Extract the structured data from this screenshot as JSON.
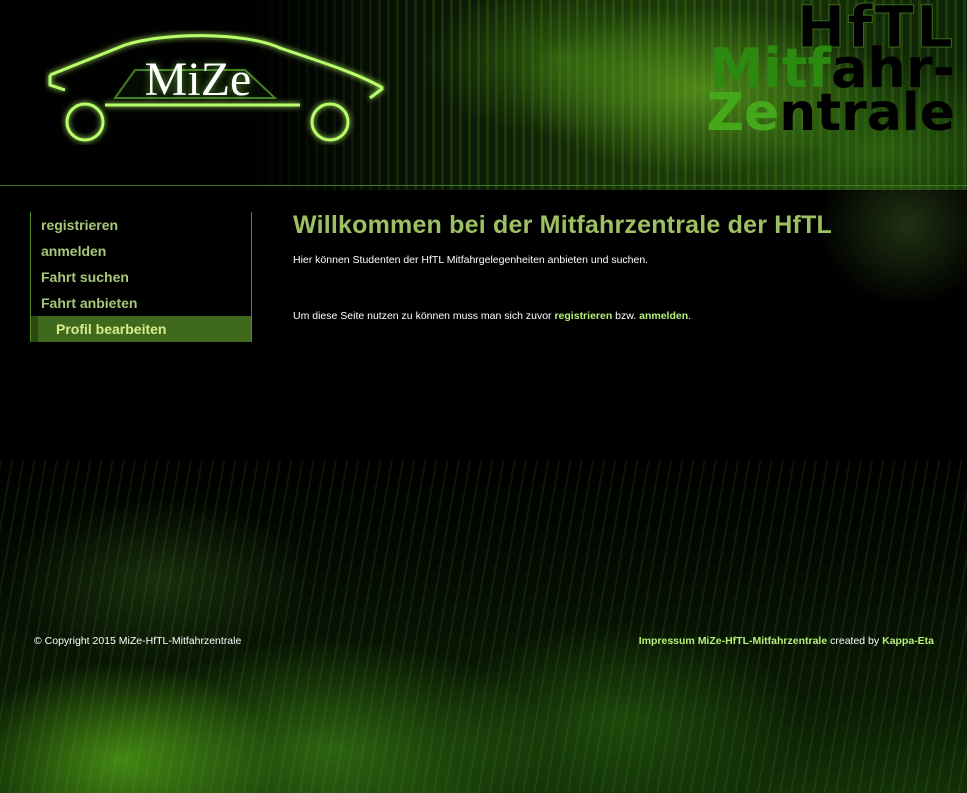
{
  "logo": {
    "text": "MiZe"
  },
  "brand": {
    "line1": "HfTL",
    "line2_green": "Mitf",
    "line2_dark": "ahr-",
    "line3_green": "Ze",
    "line3_dark": "ntrale"
  },
  "sidebar": {
    "items": [
      {
        "label": "registrieren",
        "active": false
      },
      {
        "label": "anmelden",
        "active": false
      },
      {
        "label": "Fahrt suchen",
        "active": false
      },
      {
        "label": "Fahrt anbieten",
        "active": false
      },
      {
        "label": "Profil bearbeiten",
        "active": true
      }
    ]
  },
  "main": {
    "title": "Willkommen bei der Mitfahrzentrale der HfTL",
    "intro": "Hier können Studenten der HfTL Mitfahrgelegenheiten anbieten und suchen.",
    "note_prefix": "Um diese Seite nutzen zu können muss man sich zuvor ",
    "note_link1": "registrieren",
    "note_middle": " bzw. ",
    "note_link2": "anmelden",
    "note_suffix": "."
  },
  "footer": {
    "copyright": "© Copyright 2015 MiZe-HfTL-Mitfahrzentrale",
    "impressum_link": "Impressum MiZe-HfTL-Mitfahrzentrale",
    "created_by_text": " created by ",
    "author_link": "Kappa-Eta"
  },
  "colors": {
    "accent": "#9cc062",
    "link": "#b6f07a",
    "nav_active_bg": "#3f6a1e"
  }
}
